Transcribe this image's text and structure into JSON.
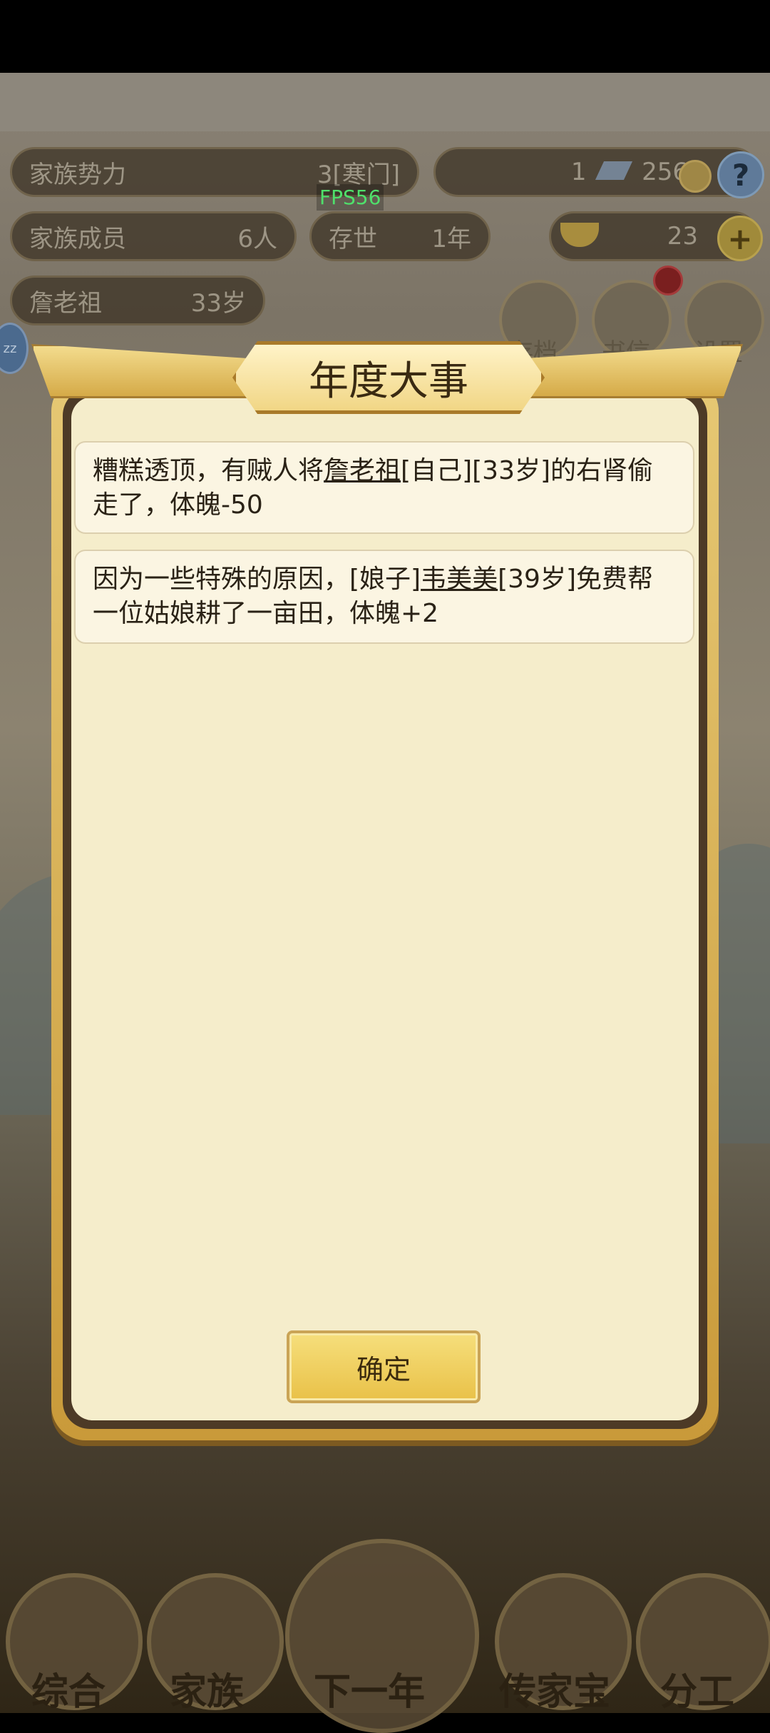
{
  "overlay": {
    "fps": "FPS56"
  },
  "hud": {
    "family_power_label": "家族势力",
    "family_power_value": "3[寒门]",
    "silver_count": "1",
    "copper_count": "256",
    "members_label": "家族成员",
    "members_value": "6人",
    "era_label": "存世",
    "era_value": "1年",
    "gold_count": "23",
    "character_name": "詹老祖",
    "character_age": "33岁",
    "sleep_badge": "zz",
    "help": "?"
  },
  "side_buttons": [
    "存档",
    "书信",
    "设置"
  ],
  "bottom_nav": [
    "综合",
    "家族",
    "下一年",
    "传家宝",
    "分工"
  ],
  "dialog": {
    "title": "年度大事",
    "events": [
      {
        "prefix": "糟糕透顶，有贼人将",
        "name": "詹老祖",
        "suffix": "[自己][33岁]的右肾偷走了，体魄-50"
      },
      {
        "prefix": "因为一些特殊的原因，[娘子]",
        "name": "韦美美",
        "suffix": "[39岁]免费帮一位姑娘耕了一亩田，体魄+2"
      }
    ],
    "confirm": "确定"
  },
  "colors": {
    "panel_bg": "#f5edcb",
    "gold_frame": "#d7ad4c",
    "button_gold": "#f0cf5e",
    "fps_green": "#4fe06b"
  }
}
